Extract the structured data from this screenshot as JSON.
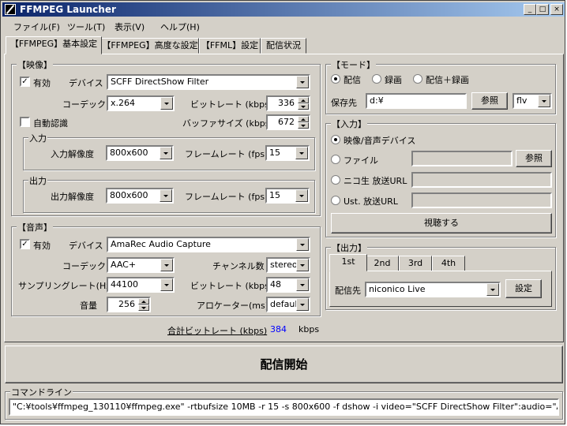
{
  "window": {
    "title": "FFMPEG Launcher",
    "minimize": "_",
    "maximize": "□",
    "close": "×"
  },
  "menu": [
    "ファイル(F)",
    "ツール(T)",
    "表示(V)",
    "ヘルプ(H)"
  ],
  "tabs": [
    "【FFMPEG】基本設定",
    "【FFMPEG】高度な設定",
    "【FFML】設定",
    "配信状況"
  ],
  "video": {
    "group_label": "【映像】",
    "enabled_label": "有効",
    "enabled": true,
    "device_label": "デバイス",
    "device": "SCFF DirectShow Filter",
    "codec_label": "コーデック",
    "codec": "x.264",
    "bitrate_label": "ビットレート (kbps)",
    "bitrate": "336",
    "auto_label": "自動認識",
    "auto": false,
    "buffer_label": "バッファサイズ (kbps)",
    "buffer": "672",
    "input_group": "入力",
    "input_res_label": "入力解像度",
    "input_res": "800x600",
    "input_fps_label": "フレームレート (fps)",
    "input_fps": "15",
    "output_group": "出力",
    "output_res_label": "出力解像度",
    "output_res": "800x600",
    "output_fps_label": "フレームレート (fps)",
    "output_fps": "15"
  },
  "audio": {
    "group_label": "【音声】",
    "enabled_label": "有効",
    "enabled": true,
    "device_label": "デバイス",
    "device": "AmaRec Audio Capture",
    "codec_label": "コーデック",
    "codec": "AAC+",
    "channels_label": "チャンネル数",
    "channels": "stereo",
    "samplerate_label": "サンプリングレート(Hz)",
    "samplerate": "44100",
    "bitrate_label": "ビットレート (kbps)",
    "bitrate": "48",
    "volume_label": "音量",
    "volume": "256",
    "allocator_label": "アロケーター(ms)",
    "allocator": "default"
  },
  "total": {
    "label": "合計ビットレート (kbps)",
    "value": "384",
    "unit": "kbps",
    "value_color": "#0000ff"
  },
  "mode": {
    "group_label": "【モード】",
    "options": [
      "配信",
      "録画",
      "配信＋録画"
    ],
    "selected": 0,
    "save_label": "保存先",
    "save_path": "d:¥",
    "browse": "参照",
    "format": "flv"
  },
  "input": {
    "group_label": "【入力】",
    "options": [
      "映像/音声デバイス",
      "ファイル",
      "ニコ生 放送URL",
      "Ust. 放送URL"
    ],
    "selected": 0,
    "browse": "参照",
    "watch": "視聴する"
  },
  "output": {
    "group_label": "【出力】",
    "tabs": [
      "1st",
      "2nd",
      "3rd",
      "4th"
    ],
    "dest_label": "配信先",
    "dest": "niconico Live",
    "settings": "設定"
  },
  "start_button": "配信開始",
  "cmdline": {
    "label": "コマンドライン",
    "value": "\"C:¥tools¥ffmpeg_130110¥ffmpeg.exe\" -rtbufsize 10MB -r 15 -s 800x600 -f dshow -i video=\"SCFF DirectShow Filter\":audio=\"AmaRec"
  }
}
